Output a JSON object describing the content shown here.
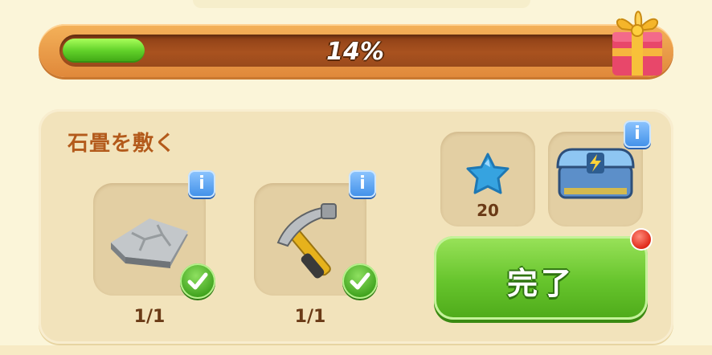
{
  "progress": {
    "percent_label": "14%",
    "fraction": 0.14
  },
  "task": {
    "title": "石畳を敷く"
  },
  "requirements": [
    {
      "icon": "stone-slab-icon",
      "count": "1/1",
      "completed": true
    },
    {
      "icon": "hammer-icon",
      "count": "1/1",
      "completed": true
    }
  ],
  "rewards": [
    {
      "icon": "blue-star-icon",
      "amount": "20"
    },
    {
      "icon": "blue-chest-icon"
    }
  ],
  "info_label": "i",
  "complete_button": {
    "label": "完了"
  },
  "colors": {
    "progress_green": "#62d12a",
    "title_orange": "#b35a1b",
    "button_green": "#66c42c",
    "info_blue": "#3f8fe8",
    "notify_red": "#e02a1a"
  }
}
